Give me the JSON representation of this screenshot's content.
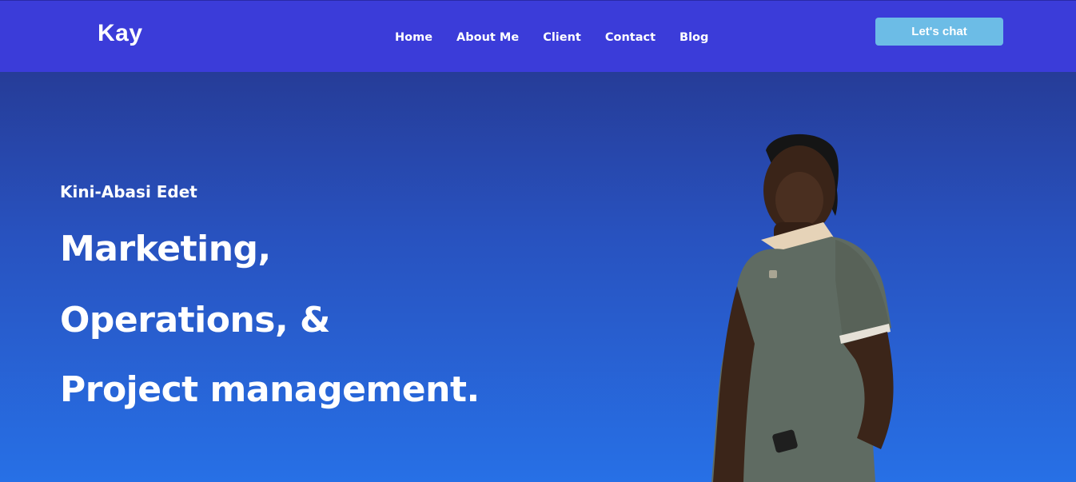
{
  "nav": {
    "logo": "Kay",
    "links": [
      "Home",
      "About Me",
      "Client",
      "Contact",
      "Blog"
    ],
    "cta": "Let's chat"
  },
  "hero": {
    "name": "Kini-Abasi Edet",
    "headline": [
      "Marketing,",
      "Operations, &",
      "Project management."
    ]
  },
  "colors": {
    "navbar": "#3b3cd9",
    "cta": "#6cbce6",
    "hero_top": "#263c98",
    "hero_bottom": "#2770e6",
    "shirt": "#5f6b62"
  }
}
